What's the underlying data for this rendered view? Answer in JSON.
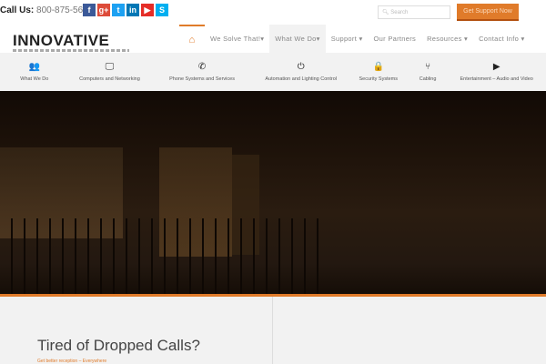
{
  "topbar": {
    "call_label": "Call Us:",
    "phone": "800-875-5675",
    "social": [
      {
        "icon": "facebook-icon",
        "glyph": "f",
        "color": "#3b5998"
      },
      {
        "icon": "google-plus-icon",
        "glyph": "g+",
        "color": "#dd4b39"
      },
      {
        "icon": "twitter-icon",
        "glyph": "t",
        "color": "#1da1f2"
      },
      {
        "icon": "linkedin-icon",
        "glyph": "in",
        "color": "#0077b5"
      },
      {
        "icon": "youtube-icon",
        "glyph": "▶",
        "color": "#e52d27"
      },
      {
        "icon": "skype-icon",
        "glyph": "S",
        "color": "#00aff0"
      }
    ],
    "search_placeholder": "Search",
    "support_button": "Get Support Now"
  },
  "logo": "INNOVATIVE",
  "nav": {
    "home_icon": "⌂",
    "items": [
      "We Solve That!▾",
      "What We Do▾",
      "Support ▾",
      "Our Partners",
      "Resources ▾",
      "Contact Info ▾"
    ]
  },
  "subnav": [
    {
      "icon": "👥",
      "label": "What We Do"
    },
    {
      "icon": "🖵",
      "label": "Computers and Networking"
    },
    {
      "icon": "✆",
      "label": "Phone Systems and Services"
    },
    {
      "icon": "⏻",
      "label": "Automation and Lighting Control"
    },
    {
      "icon": "🔒",
      "label": "Security Systems"
    },
    {
      "icon": "⑂",
      "label": "Cabling"
    },
    {
      "icon": "▶",
      "label": "Entertainment – Audio and Video"
    }
  ],
  "content": {
    "heading": "Tired of Dropped Calls?",
    "subheading": "Get better reception – Everywhere"
  },
  "colors": {
    "accent": "#e07b2a"
  }
}
